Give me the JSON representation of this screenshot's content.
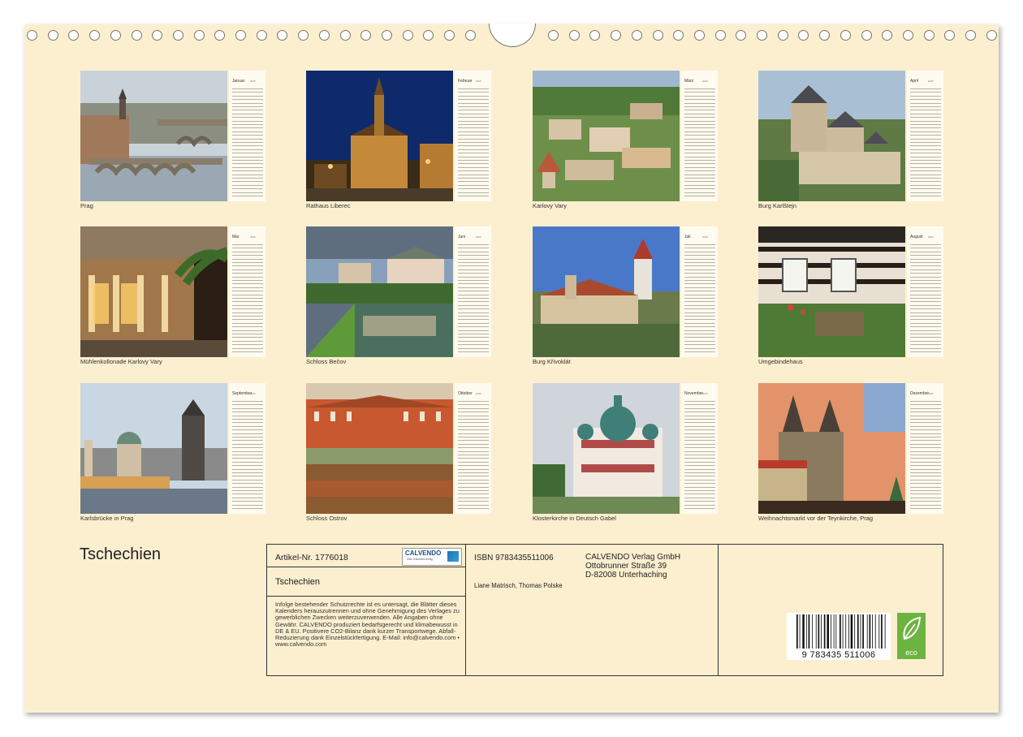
{
  "title": "Tschechien",
  "months": [
    {
      "month": "Januar",
      "caption": "Prag"
    },
    {
      "month": "Februar",
      "caption": "Rathaus Liberec"
    },
    {
      "month": "März",
      "caption": "Karlovy Vary"
    },
    {
      "month": "April",
      "caption": "Burg Karlštejn"
    },
    {
      "month": "Mai",
      "caption": "Mühlenkollonade Karlovy Vary"
    },
    {
      "month": "Juni",
      "caption": "Schloss Bečov"
    },
    {
      "month": "Juli",
      "caption": "Burg Křivoklát"
    },
    {
      "month": "August",
      "caption": "Umgebindehaus"
    },
    {
      "month": "September",
      "caption": "Karlsbrücke in Prag"
    },
    {
      "month": "Oktober",
      "caption": "Schloss Ostrov"
    },
    {
      "month": "November",
      "caption": "Klosterkirche in Deutsch Gabel"
    },
    {
      "month": "Dezember",
      "caption": "Weihnachtsmarkt vor der Teynkirche, Prag"
    }
  ],
  "year": "2025",
  "info": {
    "article": "Artikel-Nr. 1776018",
    "calendar_title": "Tschechien",
    "legal": "Infolge bestehender Schutzrechte ist es untersagt, die Blätter dieses Kalenders herauszutrennen und ohne Genehmigung des Verlages zu gewerblichen Zwecken weiterzuverwenden. Alle Angaben ohne Gewähr. CALVENDO produziert bedarfsgerecht und klimabewusst in DE & EU. Positivere CO2-Bilanz dank kurzer Transportwege. Abfall-Reduzierung dank Einzelstückfertigung. E-Mail: info@calvendo.com • www.calvendo.com",
    "logo_brand": "CALVENDO",
    "logo_tagline": "Dein Kalenderverlag",
    "isbn": "ISBN 9783435511006",
    "authors": "Liane Matrisch, Thomas Polske",
    "publisher": "CALVENDO Verlag GmbH",
    "street": "Ottobrunner Straße 39",
    "city": "D-82008 Unterhaching",
    "barcode_number": "9 783435 511006",
    "eco_label": "eco"
  }
}
